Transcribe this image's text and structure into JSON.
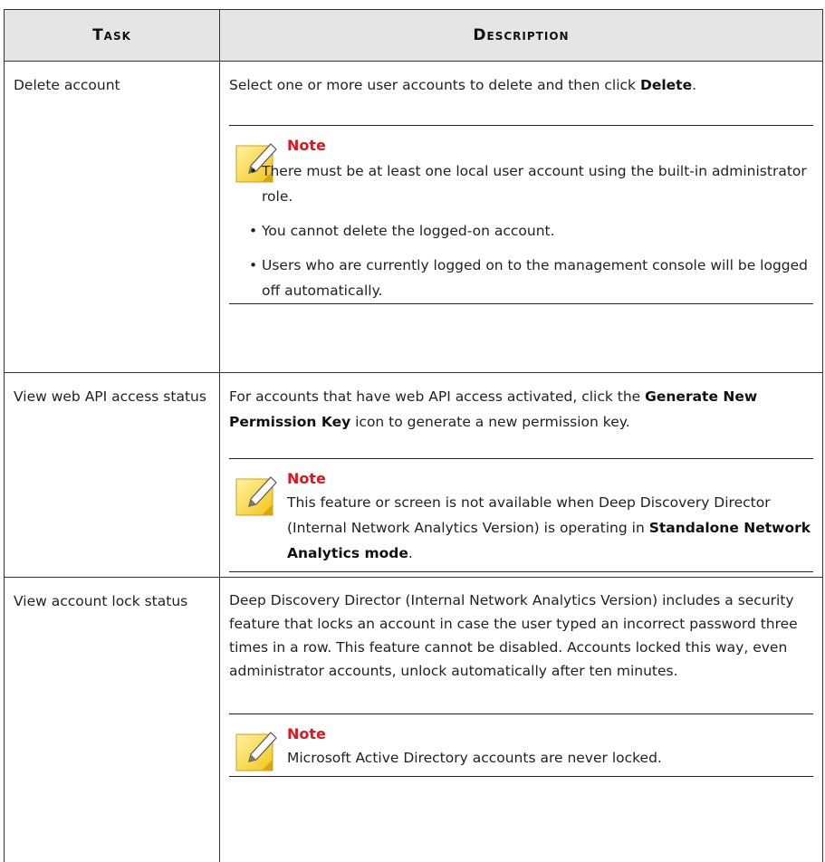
{
  "headers": {
    "task": "Task",
    "description": "Description"
  },
  "rows": [
    {
      "task": "Delete account",
      "desc_pre": "Select one or more user accounts to delete and then click ",
      "desc_bold": "Delete",
      "desc_post": ".",
      "note_title": "Note",
      "note_items": [
        "There must be at least one local user account using the built-in administrator role.",
        "You cannot delete the logged-on account.",
        "Users who are currently logged on to the management console will be logged off automatically."
      ]
    },
    {
      "task": "View web API access status",
      "desc_pre": "For accounts that have web API access activated, click the ",
      "desc_bold": "Generate New Permission Key",
      "desc_post": " icon to generate a new permission key.",
      "note_title": "Note",
      "note_pre": "This feature or screen is not available when Deep Discovery Director (Internal Network Analytics Version) is operating in ",
      "note_bold": "Standalone Network Analytics mode",
      "note_post": "."
    },
    {
      "task": "View account lock status",
      "desc": "Deep Discovery Director (Internal Network Analytics Version) includes a security feature that locks an account in case the user typed an incorrect password three times in a row. This feature cannot be disabled. Accounts locked this way, even administrator accounts, unlock automatically after ten minutes.",
      "note_title": "Note",
      "note_text": "Microsoft Active Directory accounts are never locked."
    }
  ]
}
